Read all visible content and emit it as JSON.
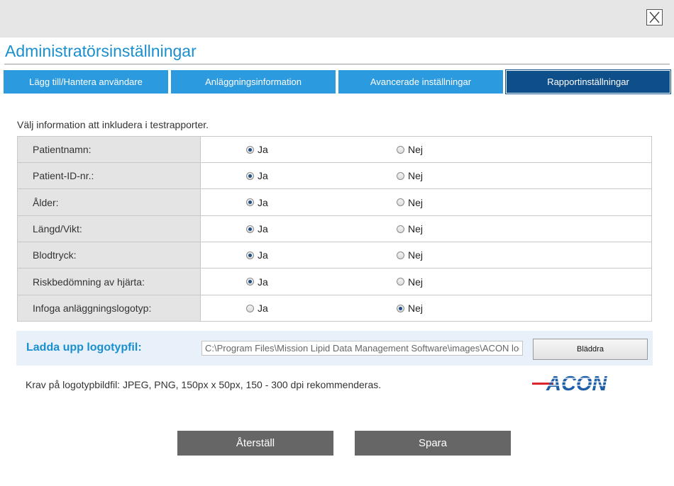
{
  "window": {
    "close_icon": "close-x-icon"
  },
  "title": "Administratörsinställningar",
  "tabs": [
    {
      "label": "Lägg till/Hantera användare",
      "active": false
    },
    {
      "label": "Anläggningsinformation",
      "active": false
    },
    {
      "label": "Avancerade inställningar",
      "active": false
    },
    {
      "label": "Rapportinställningar",
      "active": true
    }
  ],
  "intro_text": "Välj information att inkludera i testrapporter.",
  "options": {
    "yes_label": "Ja",
    "no_label": "Nej",
    "rows": [
      {
        "label": "Patientnamn:",
        "selected": "yes"
      },
      {
        "label": "Patient-ID-nr.:",
        "selected": "yes"
      },
      {
        "label": "Ålder:",
        "selected": "yes"
      },
      {
        "label": "Längd/Vikt:",
        "selected": "yes"
      },
      {
        "label": "Blodtryck:",
        "selected": "yes"
      },
      {
        "label": "Riskbedömning av hjärta:",
        "selected": "yes"
      },
      {
        "label": "Infoga anläggningslogotyp:",
        "selected": "no"
      }
    ]
  },
  "upload": {
    "label": "Ladda upp logotypfil:",
    "path_value": "C:\\Program Files\\Mission Lipid Data Management Software\\images\\ACON logo.png",
    "browse_label": "Bläddra"
  },
  "requirements_text": "Krav på logotypbildfil: JPEG, PNG, 150px x 50px, 150 - 300 dpi rekommenderas.",
  "logo": {
    "text": "ACON",
    "color": "#1f5fa6",
    "accent_color": "#d9262e"
  },
  "buttons": {
    "reset_label": "Återställ",
    "save_label": "Spara"
  },
  "colors": {
    "accent": "#1a8fd0",
    "tab": "#2b9ade",
    "tab_active": "#0e4f8a",
    "button": "#666666"
  }
}
